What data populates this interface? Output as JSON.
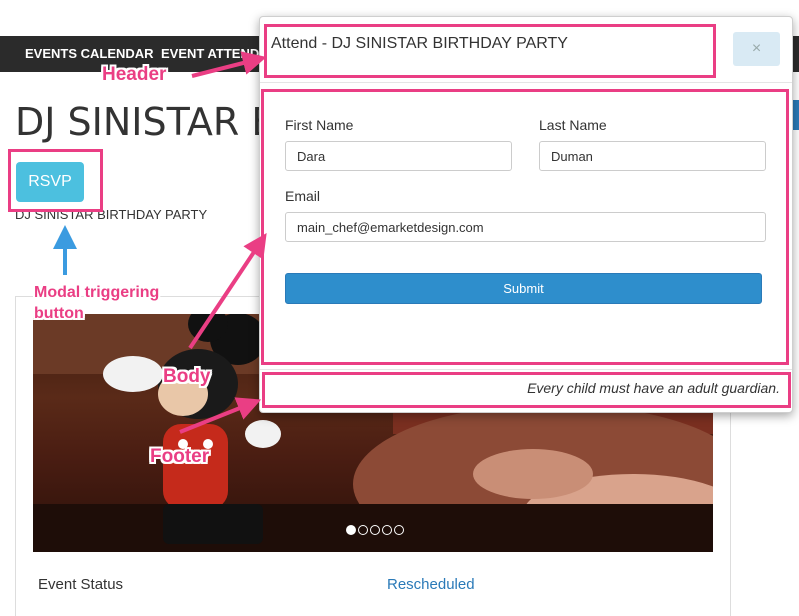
{
  "nav": {
    "items": [
      "EVENTS CALENDAR",
      "EVENT ATTENDEES"
    ]
  },
  "page": {
    "title": "DJ SINISTAR BIRTHDAY PARTY",
    "rsvp_label": "RSVP",
    "subtitle": "DJ SINISTAR BIRTHDAY PARTY",
    "event_status_label": "Event Status",
    "event_status_value": "Rescheduled",
    "slider_dots": 5,
    "slider_active_index": 0
  },
  "modal": {
    "title": "Attend - DJ SINISTAR BIRTHDAY PARTY",
    "close_symbol": "×",
    "fields": {
      "first_name": {
        "label": "First Name",
        "value": "Dara"
      },
      "last_name": {
        "label": "Last Name",
        "value": "Duman"
      },
      "email": {
        "label": "Email",
        "value": "main_chef@emarketdesign.com"
      }
    },
    "submit_label": "Submit",
    "footer_text": "Every child must have an adult guardian."
  },
  "annotations": {
    "header": "Header",
    "body": "Body",
    "footer": "Footer",
    "trigger_line1": "Modal triggering",
    "trigger_line2": "button",
    "color": "#ea3e84"
  },
  "colors": {
    "nav_bg": "#2b2b2b",
    "rsvp_bg": "#4cc0df",
    "submit_bg": "#2e8ecc",
    "link": "#2a7ab8",
    "annotation": "#ea3e84"
  }
}
